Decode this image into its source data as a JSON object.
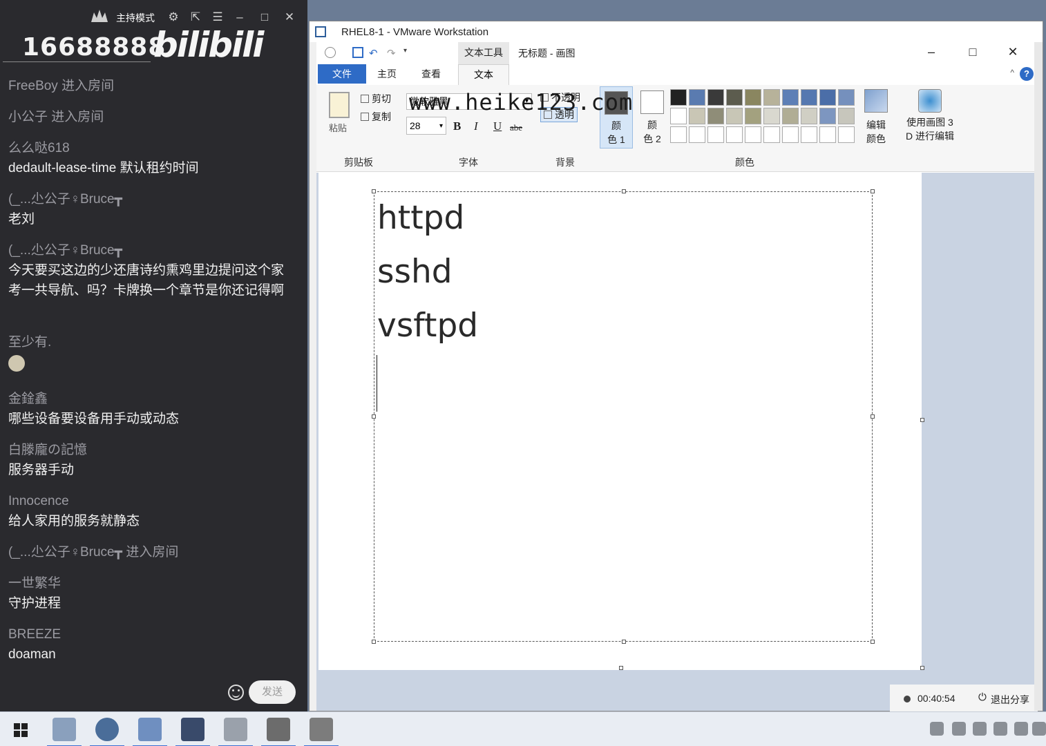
{
  "chat": {
    "mode_label": "主持模式",
    "room_id": "16688888",
    "brand": "bilibili",
    "messages": [
      {
        "user": "FreeBoy",
        "enter": "进入房间",
        "text": ""
      },
      {
        "user": "小公子",
        "enter": "进入房间",
        "text": ""
      },
      {
        "user": "么么哒618",
        "enter": "",
        "text": "dedault-lease-time 默认租约时间"
      },
      {
        "user": "(_...尐公子♀Bruce┳",
        "enter": "",
        "text": "老刘"
      },
      {
        "user": "(_...尐公子♀Bruce┳",
        "enter": "",
        "text": "今天要买这边的少还唐诗约熏鸡里边提问这个家考一共导航、吗？卡牌换一个章节是你还记得啊"
      },
      {
        "user": "至少有.",
        "enter": "",
        "text": ""
      },
      {
        "user": "金鍂鑫",
        "enter": "",
        "text": "哪些设备要设备用手动或动态"
      },
      {
        "user": "白滕龐の記憶",
        "enter": "",
        "text": "服务器手动"
      },
      {
        "user": "Innocence",
        "enter": "",
        "text": "给人家用的服务就静态"
      },
      {
        "user": "(_...尐公子♀Bruce┳",
        "enter": "进入房间",
        "text": ""
      },
      {
        "user": "一世繁华",
        "enter": "",
        "text": "守护进程"
      },
      {
        "user": "BREEZE",
        "enter": "",
        "text": "doaman"
      }
    ],
    "send_label": "发送"
  },
  "vmware": {
    "title": "RHEL8-1 - VMware Workstation"
  },
  "paint": {
    "context_tab": "文本工具",
    "title": "无标题 - 画图",
    "tabs": {
      "file": "文件",
      "home": "主页",
      "view": "查看",
      "text": "文本"
    },
    "clipboard": {
      "paste": "粘贴",
      "cut": "剪切",
      "copy": "复制",
      "group": "剪贴板"
    },
    "font": {
      "family": "微软雅黑",
      "size": "28",
      "bold": "B",
      "italic": "I",
      "underline": "U",
      "strike": "abe",
      "group": "字体"
    },
    "background": {
      "opaque": "不透明",
      "transparent": "透明",
      "group": "背景"
    },
    "colors": {
      "color1_line1": "颜",
      "color1_line2": "色 1",
      "color2_line1": "颜",
      "color2_line2": "色 2",
      "edit_line1": "编辑",
      "edit_line2": "颜色",
      "p3d_line1": "使用画图 3",
      "p3d_line2": "D 进行编辑",
      "group": "颜色",
      "color1": "#555555",
      "color2": "#ffffff",
      "palette": [
        "#222222",
        "#5a7bb0",
        "#3a3a3a",
        "#5c5c4e",
        "#8a8660",
        "#b7b29a",
        "#5d7fb6",
        "#5578b0",
        "#4b6ea8",
        "#7590bd",
        "#ffffff",
        "#c9c6b5",
        "#8f8d78",
        "#c8c6b6",
        "#a3a17f",
        "#d9d8cf",
        "#b0ad95",
        "#d0cfc4",
        "#7d96c0",
        "#c7c6bc",
        "#ffffff",
        "#ffffff",
        "#ffffff",
        "#ffffff",
        "#ffffff",
        "#ffffff",
        "#ffffff",
        "#ffffff",
        "#ffffff",
        "#ffffff"
      ]
    },
    "canvas_lines": [
      "httpd",
      "sshd",
      "vsftpd"
    ]
  },
  "watermark": "www.heike123.com",
  "share": {
    "timer": "00:40:54",
    "exit": "退出分享"
  }
}
